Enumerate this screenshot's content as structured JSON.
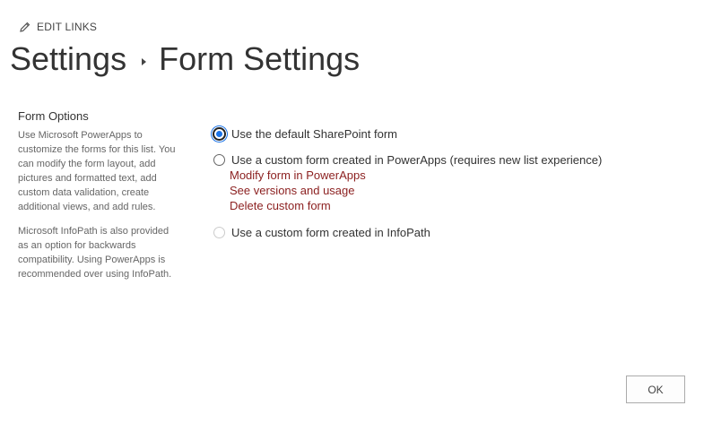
{
  "header": {
    "edit_links_label": "EDIT LINKS",
    "breadcrumb_parent": "Settings",
    "breadcrumb_current": "Form Settings"
  },
  "left_panel": {
    "section_title": "Form Options",
    "description_1": "Use Microsoft PowerApps to customize the forms for this list. You can modify the form layout, add pictures and formatted text, add custom data validation, create additional views, and add rules.",
    "description_2": "Microsoft InfoPath is also provided as an option for backwards compatibility. Using PowerApps is recommended over using InfoPath."
  },
  "options": {
    "default_form_label": "Use the default SharePoint form",
    "powerapps_form_label": "Use a custom form created in PowerApps (requires new list experience)",
    "powerapps_links": {
      "modify": "Modify form in PowerApps",
      "versions": "See versions and usage",
      "delete": "Delete custom form"
    },
    "infopath_form_label": "Use a custom form created in InfoPath",
    "selected": "default"
  },
  "footer": {
    "ok_label": "OK"
  },
  "colors": {
    "link": "#8b1f1f",
    "radio_accent": "#1a73e8"
  },
  "icons": {
    "edit_links": "pencil-icon",
    "breadcrumb_separator": "triangle-right-icon"
  }
}
